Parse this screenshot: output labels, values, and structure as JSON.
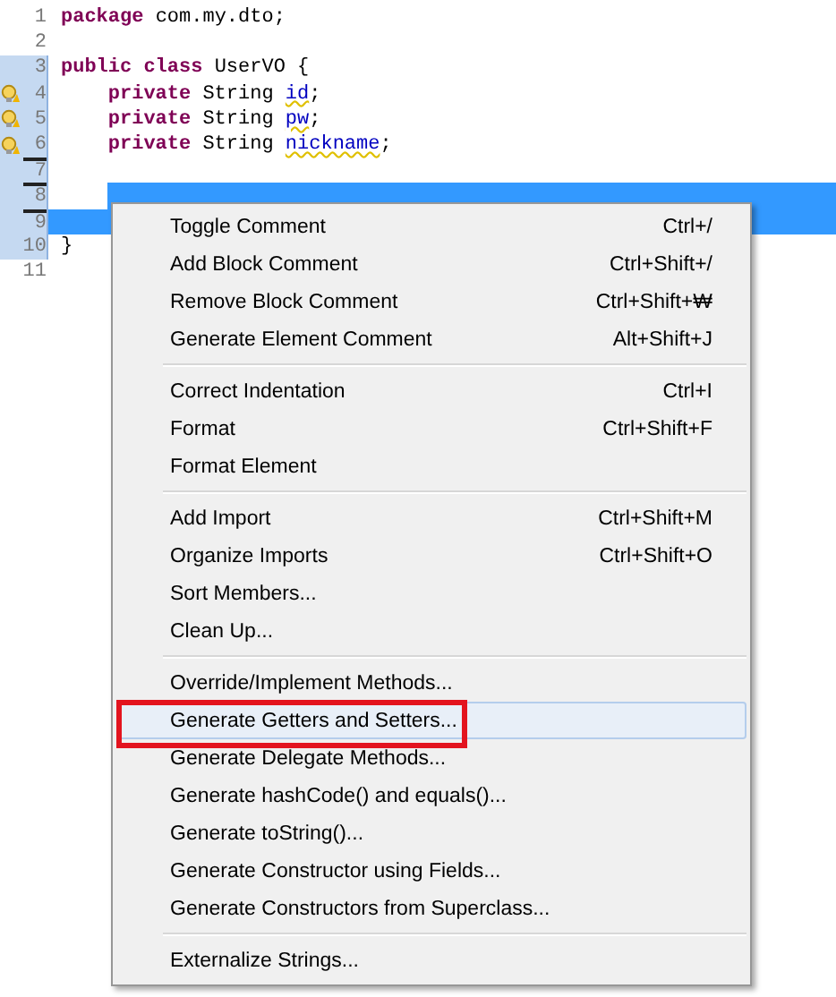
{
  "editor": {
    "lines": [
      {
        "number": "1",
        "in_range": false,
        "warning": false,
        "changed": false,
        "indented": false,
        "selected": false,
        "tokens": [
          {
            "kind": "keyword",
            "text": "package"
          },
          {
            "kind": "plain",
            "text": " com.my.dto;"
          }
        ]
      },
      {
        "number": "2",
        "in_range": false,
        "warning": false,
        "changed": false,
        "selected": false
      },
      {
        "number": "3",
        "in_range": true,
        "warning": false,
        "changed": false,
        "indented": false,
        "selected": false,
        "tokens": [
          {
            "kind": "keyword",
            "text": "public class"
          },
          {
            "kind": "plain",
            "text": " UserVO {"
          }
        ]
      },
      {
        "number": "4",
        "in_range": true,
        "warning": true,
        "changed": false,
        "indented": true,
        "selected": false,
        "tokens": [
          {
            "kind": "keyword",
            "text": "private"
          },
          {
            "kind": "plain",
            "text": " String "
          },
          {
            "kind": "field",
            "text": "id"
          },
          {
            "kind": "plain",
            "text": ";"
          }
        ]
      },
      {
        "number": "5",
        "in_range": true,
        "warning": true,
        "changed": false,
        "indented": true,
        "selected": false,
        "tokens": [
          {
            "kind": "keyword",
            "text": "private"
          },
          {
            "kind": "plain",
            "text": " String "
          },
          {
            "kind": "field",
            "text": "pw"
          },
          {
            "kind": "plain",
            "text": ";"
          }
        ]
      },
      {
        "number": "6",
        "in_range": true,
        "warning": true,
        "changed": false,
        "indented": true,
        "selected": false,
        "tokens": [
          {
            "kind": "keyword",
            "text": "private"
          },
          {
            "kind": "plain",
            "text": " String "
          },
          {
            "kind": "field",
            "text": "nickname"
          },
          {
            "kind": "plain",
            "text": ";"
          }
        ]
      },
      {
        "number": "7",
        "in_range": true,
        "warning": false,
        "changed": true,
        "selected": false
      },
      {
        "number": "8",
        "in_range": true,
        "warning": false,
        "changed": true,
        "indented": true,
        "selected": true
      },
      {
        "number": "9",
        "in_range": true,
        "warning": false,
        "changed": true,
        "indented": false,
        "selected": true
      },
      {
        "number": "10",
        "in_range": true,
        "warning": false,
        "changed": false,
        "indented": false,
        "selected": false,
        "tokens": [
          {
            "kind": "plain",
            "text": "}"
          }
        ]
      },
      {
        "number": "11",
        "in_range": false,
        "warning": false,
        "changed": false,
        "selected": false
      }
    ]
  },
  "context_menu": {
    "groups": [
      [
        {
          "label": "Toggle Comment",
          "shortcut": "Ctrl+/",
          "selected": false
        },
        {
          "label": "Add Block Comment",
          "shortcut": "Ctrl+Shift+/",
          "selected": false
        },
        {
          "label": "Remove Block Comment",
          "shortcut": "Ctrl+Shift+₩",
          "selected": false
        },
        {
          "label": "Generate Element Comment",
          "shortcut": "Alt+Shift+J",
          "selected": false
        }
      ],
      [
        {
          "label": "Correct Indentation",
          "shortcut": "Ctrl+I",
          "selected": false
        },
        {
          "label": "Format",
          "shortcut": "Ctrl+Shift+F",
          "selected": false
        },
        {
          "label": "Format Element",
          "selected": false
        }
      ],
      [
        {
          "label": "Add Import",
          "shortcut": "Ctrl+Shift+M",
          "selected": false
        },
        {
          "label": "Organize Imports",
          "shortcut": "Ctrl+Shift+O",
          "selected": false
        },
        {
          "label": "Sort Members...",
          "selected": false
        },
        {
          "label": "Clean Up...",
          "selected": false
        }
      ],
      [
        {
          "label": "Override/Implement Methods...",
          "selected": false
        },
        {
          "label": "Generate Getters and Setters...",
          "selected": true,
          "annotated": true
        },
        {
          "label": "Generate Delegate Methods...",
          "selected": false
        },
        {
          "label": "Generate hashCode() and equals()...",
          "selected": false
        },
        {
          "label": "Generate toString()...",
          "selected": false
        },
        {
          "label": "Generate Constructor using Fields...",
          "selected": false
        },
        {
          "label": "Generate Constructors from Superclass...",
          "selected": false
        }
      ],
      [
        {
          "label": "Externalize Strings...",
          "selected": false
        }
      ]
    ]
  }
}
